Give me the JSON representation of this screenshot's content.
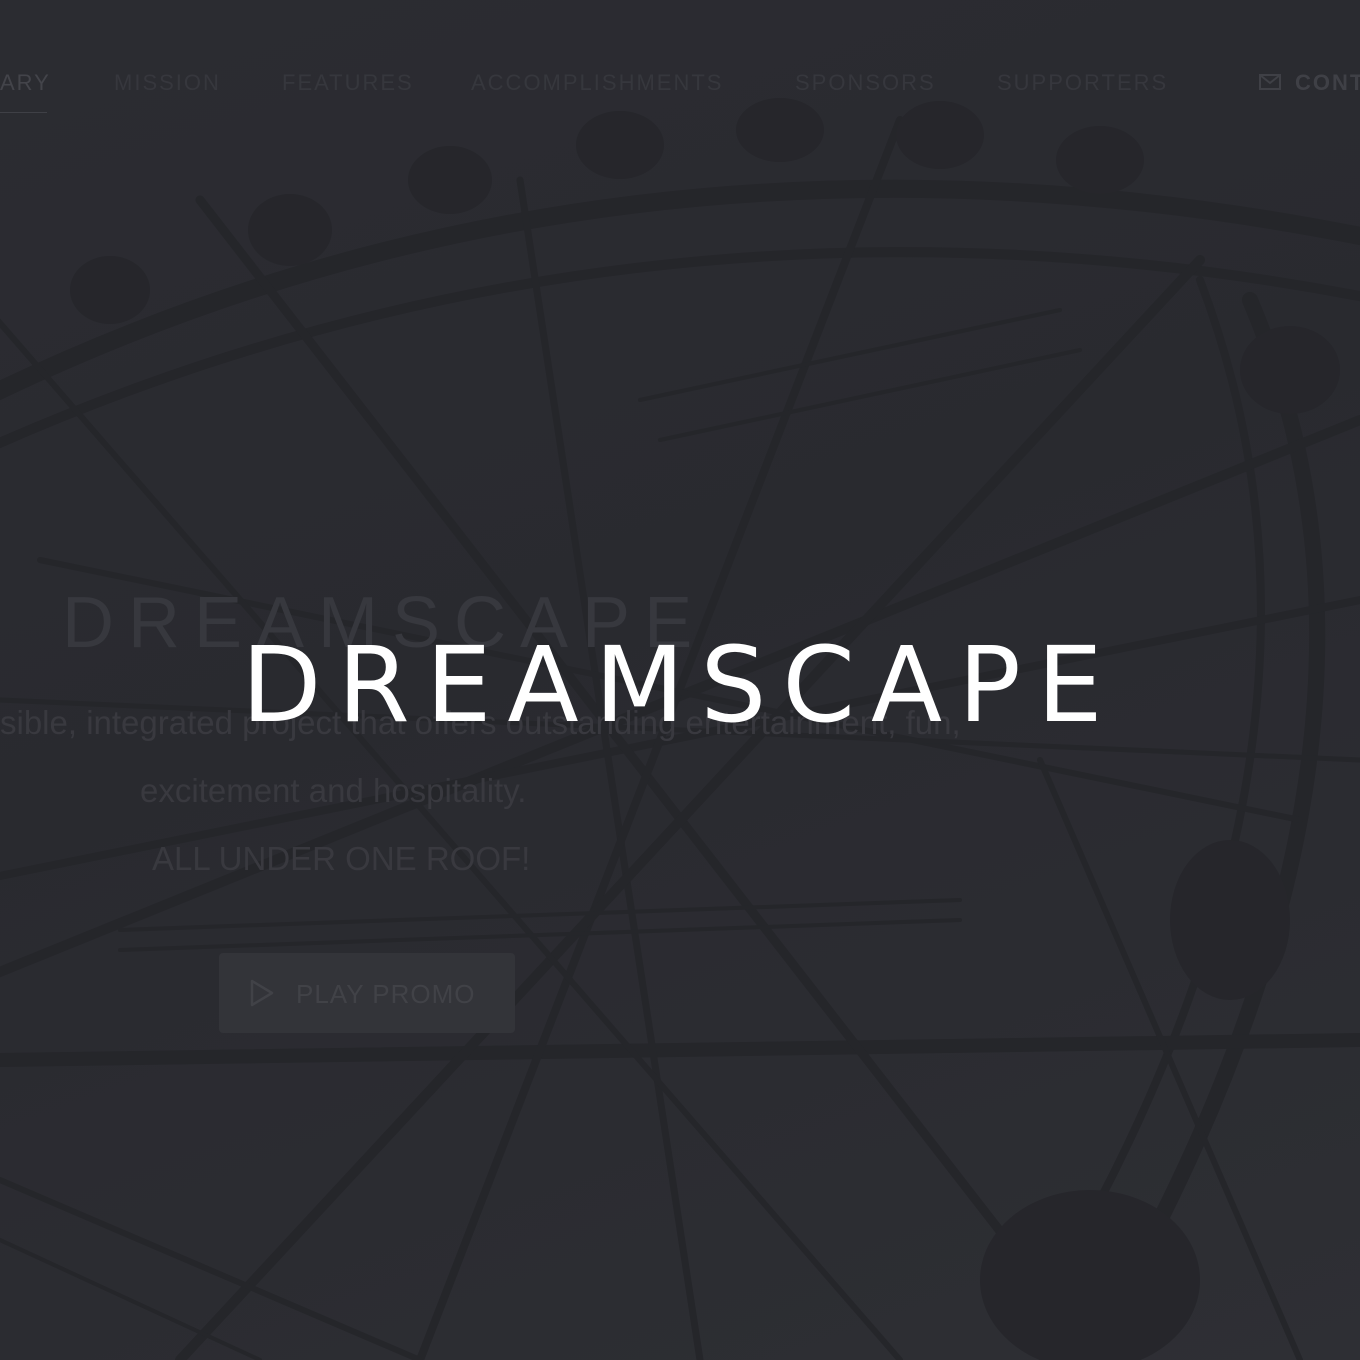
{
  "nav": {
    "items": [
      {
        "label": "ARY",
        "active": true
      },
      {
        "label": "MISSION"
      },
      {
        "label": "FEATURES"
      },
      {
        "label": "ACCOMPLISHMENTS"
      },
      {
        "label": "SPONSORS"
      },
      {
        "label": "SUPPORTERS"
      }
    ],
    "contact_label": "CONT",
    "contact_icon": "envelope-icon"
  },
  "hero": {
    "title": "DREAMSCAPE",
    "description_line_1": "sible, integrated project that offers outstanding entertainment, fun,",
    "description_line_2": "excitement and hospitality.",
    "tagline": "ALL UNDER ONE ROOF!",
    "promo_label": "PLAY PROMO",
    "promo_icon": "play-icon"
  },
  "overlay": {
    "brand_title": "DREAMSCAPE"
  },
  "colors": {
    "background": "#2b2c31",
    "overlay_text": "#ffffff",
    "dim_text": "#3d3e44"
  }
}
